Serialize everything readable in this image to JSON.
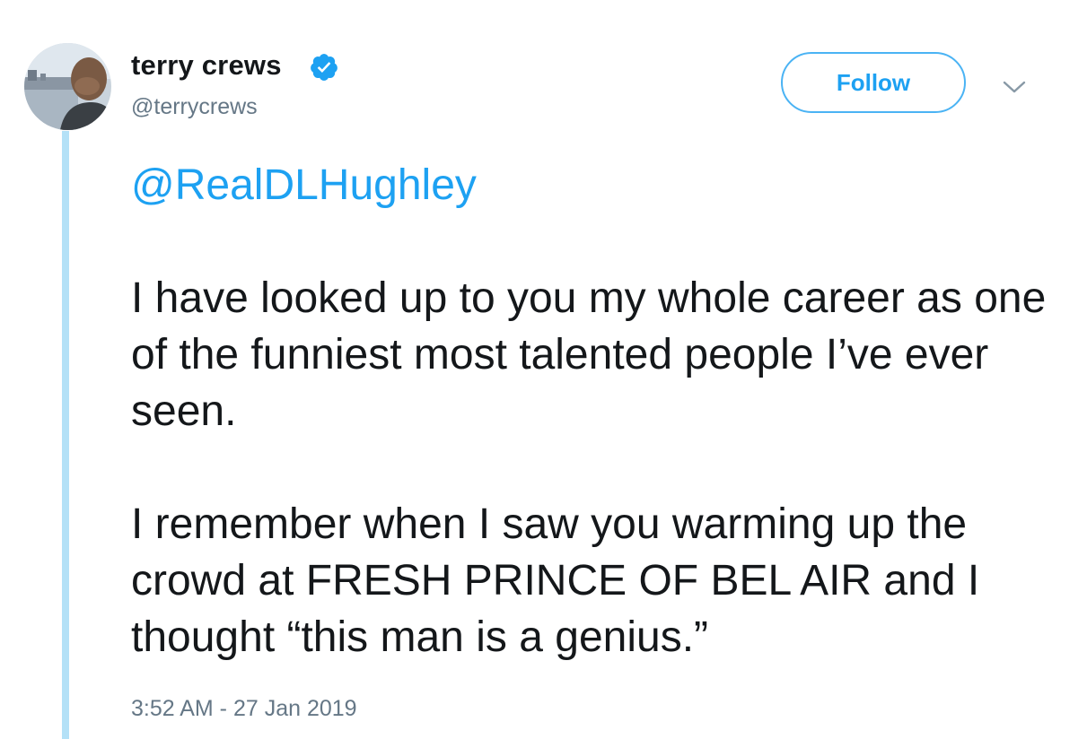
{
  "author": {
    "display_name": "terry crews",
    "handle": "@terrycrews",
    "verified": true,
    "verified_icon": "verified-badge-icon"
  },
  "actions": {
    "follow_label": "Follow",
    "menu_icon": "chevron-down-icon"
  },
  "tweet": {
    "mention": "@RealDLHughley",
    "paragraph_1": "I have looked up to you my whole career as one of the funniest most talented people I’ve ever seen.",
    "paragraph_2": "I remember when I saw you warming up the crowd at FRESH PRINCE OF BEL AIR and I thought “this man is a genius.”",
    "timestamp": "3:52 AM - 27 Jan 2019"
  },
  "colors": {
    "accent": "#1da1f2",
    "thread_line": "#b4e1f7",
    "secondary_text": "#657786",
    "primary_text": "#14171a"
  }
}
